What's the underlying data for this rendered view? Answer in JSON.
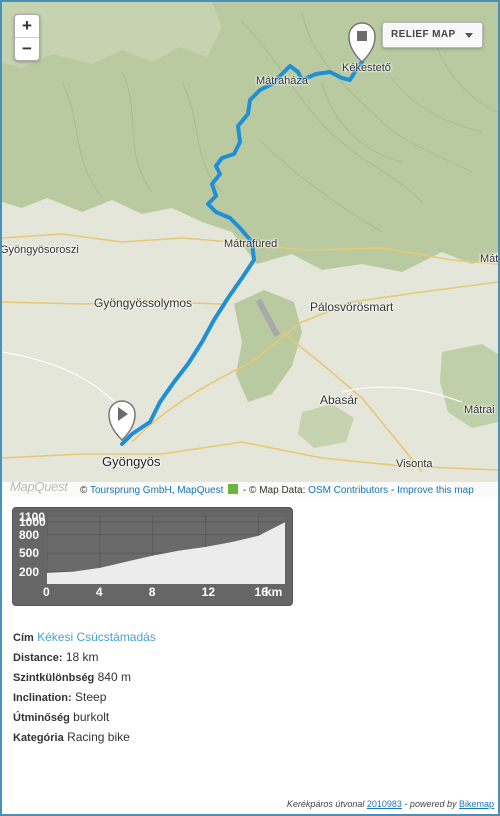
{
  "map": {
    "zoom_in": "+",
    "zoom_out": "−",
    "relief_button": "RELIEF MAP",
    "places": [
      "Kékestető",
      "Mátraháza",
      "Mátrafüred",
      "Gyöngyösoroszi",
      "Gyöngyössolymos",
      "Pálosvörösmart",
      "Abasár",
      "Mátrai",
      "Gyöngyös",
      "Visonta",
      "Mátrai"
    ],
    "attribution": {
      "logo": "MapQuest",
      "copy1": "©",
      "provider1": "Toursprung GmbH",
      "sep": ",",
      "provider2": "MapQuest",
      "copy2": "- © Map Data:",
      "osm": "OSM Contributors",
      "dash": "-",
      "improve": "Improve this map"
    },
    "colors": {
      "route": "#1f8fd6",
      "marker": "#6b6b6b",
      "forest": "#b7c89f",
      "terrain": "#e4e6d9"
    }
  },
  "chart_data": {
    "type": "area",
    "title": "",
    "xlabel": "km",
    "ylabel": "",
    "x_ticks": [
      "0",
      "4",
      "8",
      "12",
      "16"
    ],
    "y_ticks": [
      "1100",
      "1000",
      "800",
      "500",
      "200"
    ],
    "xlim": [
      0,
      18
    ],
    "ylim": [
      0,
      1100
    ],
    "x": [
      0,
      2,
      4,
      6,
      8,
      10,
      12,
      14,
      16,
      18
    ],
    "y": [
      180,
      200,
      260,
      360,
      460,
      540,
      600,
      680,
      780,
      1000
    ],
    "grid": true
  },
  "details": [
    {
      "key": "Cím",
      "value": "Kékesi Csúcstámadás",
      "link": true
    },
    {
      "key": "Distance:",
      "value": "18 km"
    },
    {
      "key": "Szintkülönbség",
      "value": "840 m"
    },
    {
      "key": "Inclination:",
      "value": "Steep"
    },
    {
      "key": "Útminőség",
      "value": "burkolt"
    },
    {
      "key": "Kategória",
      "value": "Racing bike"
    }
  ],
  "footer": {
    "prefix": "Kerékpáros útvonal",
    "route_id": "2010983",
    "middle": "- powered by",
    "brand": "Bikemap"
  }
}
